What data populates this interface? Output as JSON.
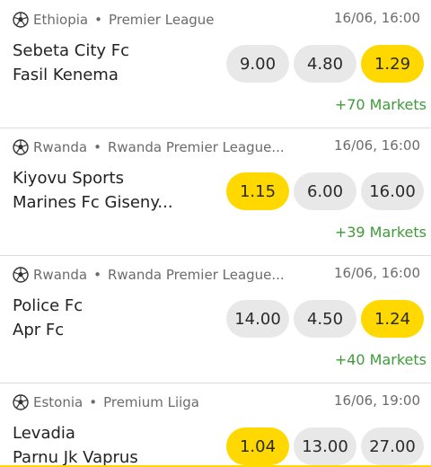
{
  "matches": [
    {
      "country": "Ethiopia",
      "league": "Premier League",
      "datetime": "16/06, 16:00",
      "home": "Sebeta City Fc",
      "away": "Fasil Kenema",
      "odds": [
        "9.00",
        "4.80",
        "1.29"
      ],
      "selected_odd": 2,
      "markets": "+70 Markets"
    },
    {
      "country": "Rwanda",
      "league": "Rwanda Premier League...",
      "datetime": "16/06, 16:00",
      "home": "Kiyovu Sports",
      "away": "Marines Fc Giseny...",
      "odds": [
        "1.15",
        "6.00",
        "16.00"
      ],
      "selected_odd": 0,
      "markets": "+39 Markets"
    },
    {
      "country": "Rwanda",
      "league": "Rwanda Premier League...",
      "datetime": "16/06, 16:00",
      "home": "Police Fc",
      "away": "Apr Fc",
      "odds": [
        "14.00",
        "4.50",
        "1.24"
      ],
      "selected_odd": 2,
      "markets": "+40 Markets"
    },
    {
      "country": "Estonia",
      "league": "Premium Liiga",
      "datetime": "16/06, 19:00",
      "home": "Levadia",
      "away": "Parnu Jk Vaprus",
      "odds": [
        "1.04",
        "13.00",
        "27.00"
      ],
      "selected_odd": 0,
      "markets": ""
    }
  ],
  "meta_separator": "•",
  "sport_icon": "soccer-ball-icon",
  "colors": {
    "selected_odd": "#ffd800",
    "odd_bg": "#e8e8e8",
    "markets_link": "#3f9a3a",
    "meta_text": "#6b6b6b"
  }
}
